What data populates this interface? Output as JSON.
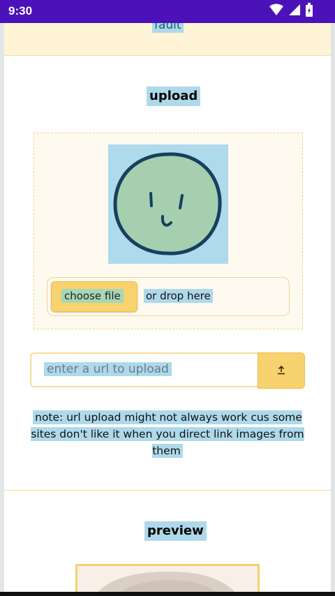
{
  "status_bar": {
    "time": "9:30",
    "icons": [
      "wifi-icon",
      "cellular-signal-icon",
      "battery-charging-icon"
    ]
  },
  "top_card": {
    "label": "fault"
  },
  "upload_section": {
    "heading": "upload",
    "file_button": "choose file",
    "drop_hint": "or drop here",
    "url_input": {
      "value": "",
      "placeholder": "enter a url to upload"
    },
    "upload_icon": "upload-arrow-icon",
    "note": "note: url upload might not always work cus some sites don't like it when you direct link images from them"
  },
  "preview_section": {
    "heading": "preview"
  },
  "colors": {
    "status_bar": "#4a12b8",
    "highlight": "#aed9ea",
    "button_yellow": "#f8d26f",
    "card_cream": "#fff5d6",
    "avatar_green": "#a5cfae",
    "avatar_outline": "#16405e"
  }
}
